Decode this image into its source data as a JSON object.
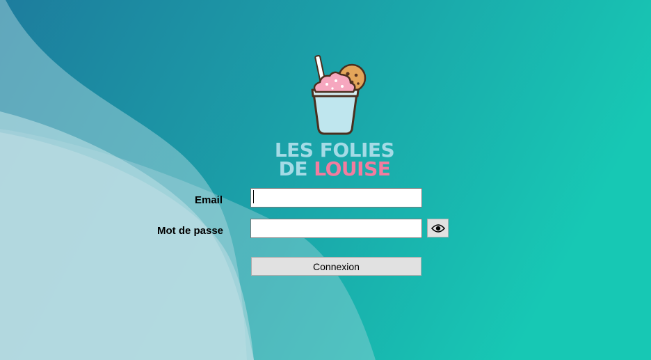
{
  "brand": {
    "line1": "LES FOLIES",
    "line2_prefix": "DE",
    "line2_name": "LOUISE",
    "logo_icon": "milkshake-cookie-icon"
  },
  "form": {
    "email_label": "Email",
    "email_value": "",
    "password_label": "Mot de passe",
    "password_value": "",
    "show_password_icon": "eye-icon",
    "submit_label": "Connexion"
  },
  "colors": {
    "bg_left": "#1d7f9f",
    "bg_right": "#17c8b4",
    "wave_light": "#c3e0e6",
    "logo_blue": "#a4dbe6",
    "logo_pink": "#f37c9f",
    "button_bg": "#e1e1e1"
  }
}
